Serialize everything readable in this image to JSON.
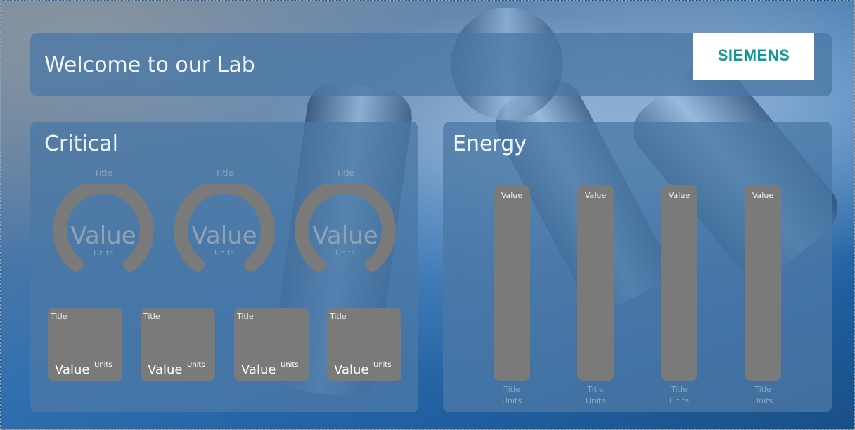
{
  "header": {
    "title": "Welcome to our Lab",
    "logo_text": "SIEMENS"
  },
  "colors": {
    "panel": "#4b78a5",
    "widget": "#7a7a7a",
    "logo_text": "#0f9a9a"
  },
  "critical": {
    "title": "Critical",
    "gauges": [
      {
        "title": "Title",
        "value": "Value",
        "units": "Units"
      },
      {
        "title": "Title",
        "value": "Value",
        "units": "Units"
      },
      {
        "title": "Title",
        "value": "Value",
        "units": "Units"
      }
    ],
    "tiles": [
      {
        "title": "Title",
        "value": "Value",
        "units": "Units"
      },
      {
        "title": "Title",
        "value": "Value",
        "units": "Units"
      },
      {
        "title": "Title",
        "value": "Value",
        "units": "Units"
      },
      {
        "title": "Title",
        "value": "Value",
        "units": "Units"
      }
    ]
  },
  "energy": {
    "title": "Energy",
    "bars": [
      {
        "value": "Value",
        "title": "Title",
        "units": "Units"
      },
      {
        "value": "Value",
        "title": "Title",
        "units": "Units"
      },
      {
        "value": "Value",
        "title": "Title",
        "units": "Units"
      },
      {
        "value": "Value",
        "title": "Title",
        "units": "Units"
      }
    ]
  }
}
